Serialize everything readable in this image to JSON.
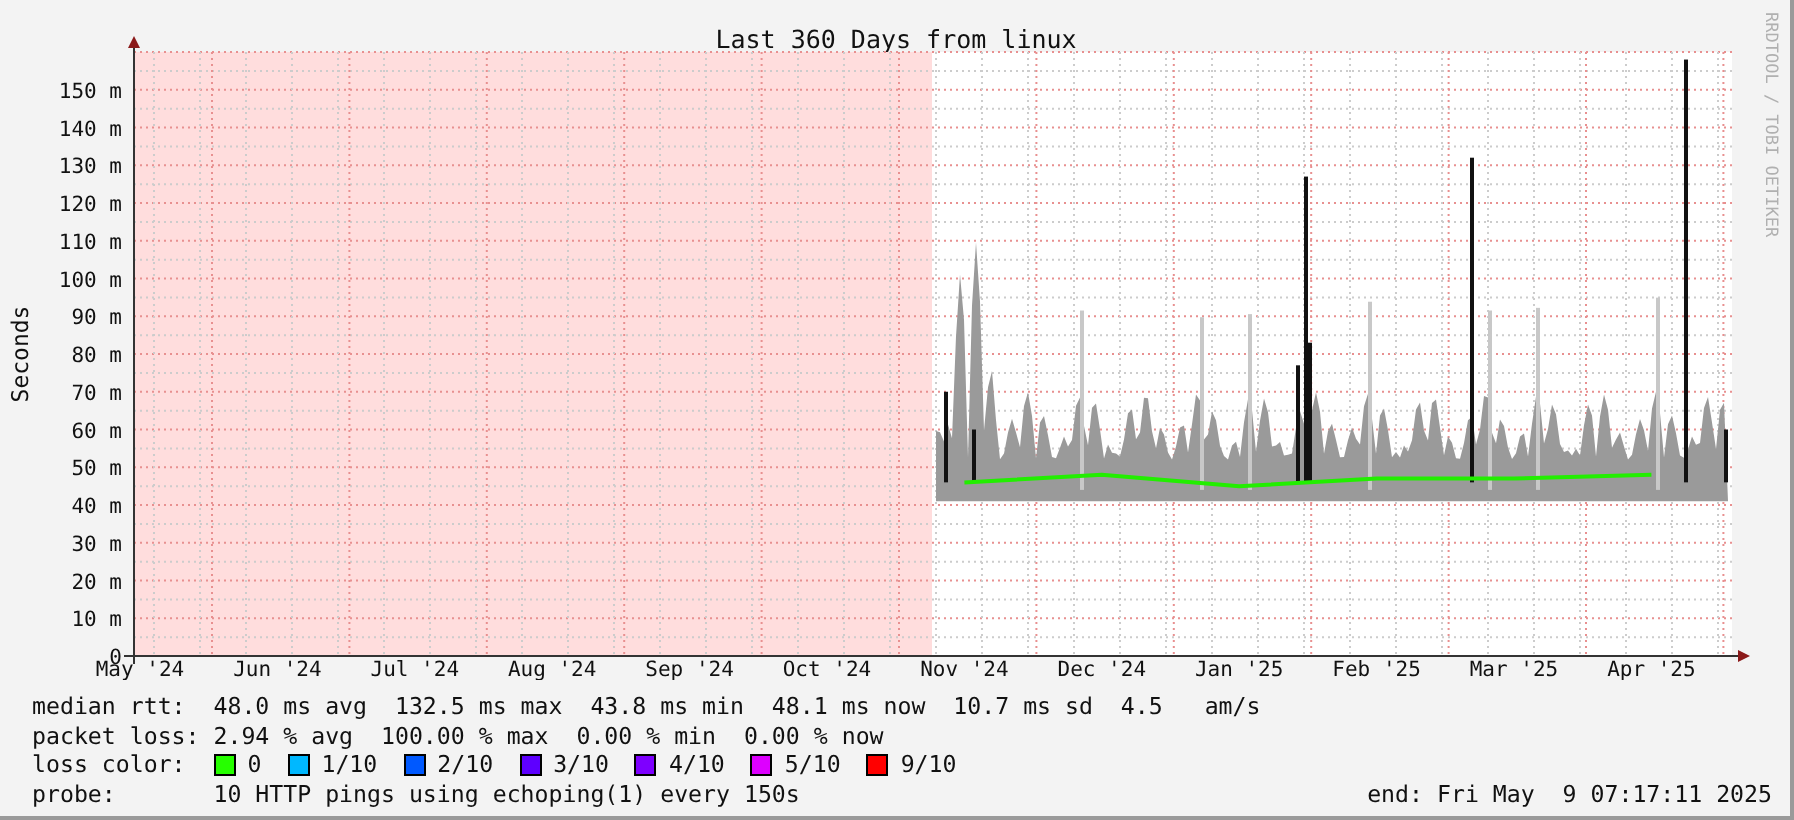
{
  "graph": {
    "credit": "RRDTOOL / TOBI OETIKER",
    "chart_data": {
      "type": "line",
      "title": "Last 360 Days from linux",
      "ylabel": "Seconds",
      "x": [
        "May '24",
        "Jun '24",
        "Jul '24",
        "Aug '24",
        "Sep '24",
        "Oct '24",
        "Nov '24",
        "Dec '24",
        "Jan '25",
        "Feb '25",
        "Mar '25",
        "Apr '25"
      ],
      "ylim": [
        0,
        160
      ],
      "grid": true,
      "yticks": [
        {
          "value": 0,
          "label": "0"
        },
        {
          "value": 10,
          "label": "10 m"
        },
        {
          "value": 20,
          "label": "20 m"
        },
        {
          "value": 30,
          "label": "30 m"
        },
        {
          "value": 40,
          "label": "40 m"
        },
        {
          "value": 50,
          "label": "50 m"
        },
        {
          "value": 60,
          "label": "60 m"
        },
        {
          "value": 70,
          "label": "70 m"
        },
        {
          "value": 80,
          "label": "80 m"
        },
        {
          "value": 90,
          "label": "90 m"
        },
        {
          "value": 100,
          "label": "100 m"
        },
        {
          "value": 110,
          "label": "110 m"
        },
        {
          "value": 120,
          "label": "120 m"
        },
        {
          "value": 130,
          "label": "130 m"
        },
        {
          "value": 140,
          "label": "140 m"
        },
        {
          "value": 150,
          "label": "150 m"
        }
      ],
      "series": [
        {
          "color": "#22ee00",
          "values": [
            null,
            null,
            null,
            null,
            null,
            null,
            46,
            48,
            45,
            47,
            47,
            48
          ]
        }
      ]
    }
  },
  "legend": {
    "rows": [
      {
        "label": "median rtt:",
        "value": "48.0 ms avg  132.5 ms max  43.8 ms min  48.1 ms now  10.7 ms sd  4.5   am/s"
      },
      {
        "label": "packet loss:",
        "value": "2.94 % avg  100.00 % max  0.00 % min  0.00 % now"
      }
    ],
    "loss_color": {
      "label": "loss color:",
      "items": [
        {
          "label": "0",
          "color": "#26ff00"
        },
        {
          "label": "1/10",
          "color": "#00b8ff"
        },
        {
          "label": "2/10",
          "color": "#0059ff"
        },
        {
          "label": "3/10",
          "color": "#5e00ff"
        },
        {
          "label": "4/10",
          "color": "#7e00ff"
        },
        {
          "label": "5/10",
          "color": "#dd00ff"
        },
        {
          "label": "9/10",
          "color": "#ff0000"
        }
      ]
    },
    "probe": {
      "label": "probe:",
      "value": "10 HTTP pings using echoping(1) every 150s"
    },
    "end": "end: Fri May  9 07:17:11 2025"
  }
}
